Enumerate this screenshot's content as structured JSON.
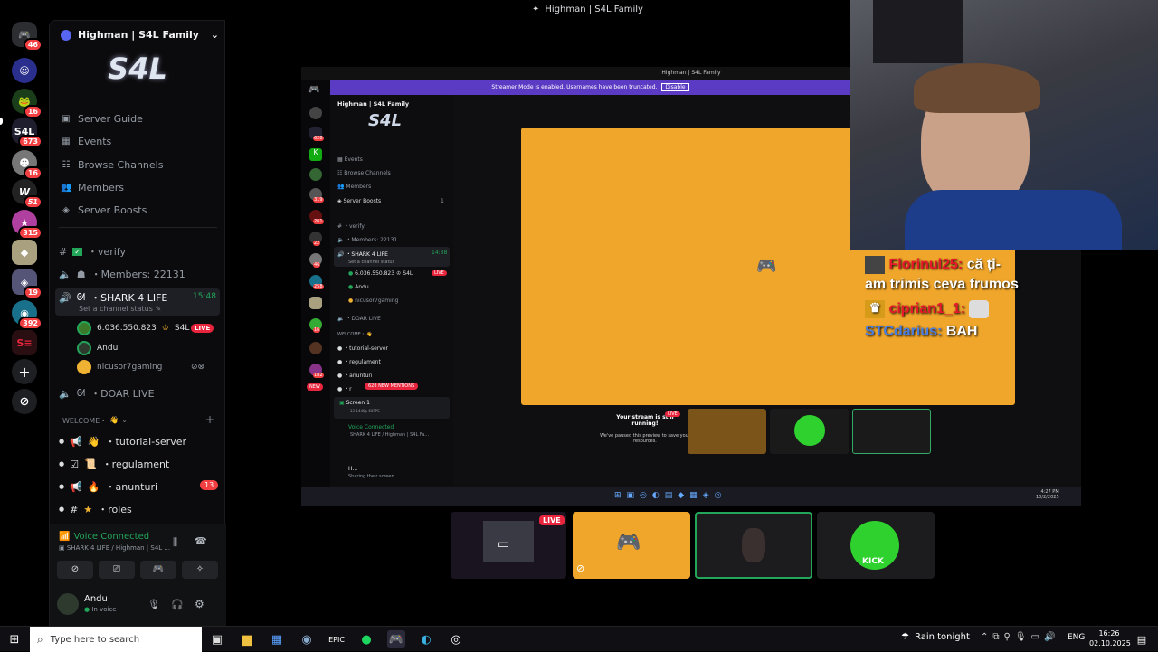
{
  "window_title": "Highman | S4L Family",
  "rail": {
    "badges": [
      "46",
      "16",
      "673",
      "16",
      "51",
      "315",
      "19",
      "392"
    ]
  },
  "server": {
    "name": "Highman | S4L Family",
    "menu": [
      {
        "icon": "guide-icon",
        "label": "Server Guide"
      },
      {
        "icon": "events-icon",
        "label": "Events"
      },
      {
        "icon": "browse-icon",
        "label": "Browse Channels"
      },
      {
        "icon": "members-icon",
        "label": "Members"
      },
      {
        "icon": "boost-icon",
        "label": "Server Boosts"
      }
    ],
    "channels": {
      "verify": "・verify",
      "members": "・Members: 22131",
      "voice": "・SHARK 4 LIFE",
      "voice_time": "15:48",
      "voice_status": "Set a channel status",
      "users": [
        {
          "name": "6.036.550.823",
          "tag": "S4L",
          "live": "LIVE"
        },
        {
          "name": "Andu"
        },
        {
          "name": "nicusor7gaming"
        }
      ],
      "doar_live": "・DOAR LIVE",
      "category": "WELCOME・",
      "text_channels": [
        {
          "label": "・tutorial-server"
        },
        {
          "label": "・regulament"
        },
        {
          "label": "・anunturi",
          "badge": "13"
        },
        {
          "label": "・roles"
        }
      ]
    },
    "voice_connected": {
      "title": "Voice Connected",
      "subtitle": "SHARK 4 LIFE / Highman | S4L ..."
    },
    "user": {
      "name": "Andu",
      "status": "In voice"
    }
  },
  "nested": {
    "title": "Highman | S4L Family",
    "banner": "Streamer Mode is enabled. Usernames have been truncated.",
    "banner_btn": "Disable",
    "server_name": "Highman | S4L Family",
    "menu": [
      "Events",
      "Browse Channels",
      "Members",
      "Server Boosts"
    ],
    "boost_count": "1",
    "verify": "・verify",
    "members": "・Members: 22131",
    "voice": "・SHARK 4 LIFE",
    "voice_time": "14:38",
    "voice_status": "Set a channel status",
    "users": [
      "6.036.550.823",
      "Andu",
      "nicusor7gaming"
    ],
    "user_tag": "S4L",
    "live": "LIVE",
    "doar_live": "・DOAR LIVE",
    "category": "WELCOME・",
    "text_channels": [
      "・tutorial-server",
      "・regulament",
      "・anunturi",
      "・r"
    ],
    "mentions": "628 NEW MENTIONS",
    "new": "NEW",
    "screen_title": "Screen 1",
    "screen_sub": "13 1440p 60FPS",
    "vc_title": "Voice Connected",
    "vc_sub": "SHARK 4 LIFE / Highman | S4L Fa...",
    "me_name": "H...",
    "me_status": "Sharing their screen",
    "stream_msg": "Your stream is still running!",
    "stream_sub": "We've paused this preview to save your resources.",
    "stream_live": "LIVE",
    "rail_badges": [
      "628",
      "319",
      "1",
      "261",
      "22",
      "46",
      "258",
      "16",
      "182"
    ],
    "clock_time": "4:27 PM",
    "clock_date": "10/2/2025"
  },
  "stream": {
    "live": "LIVE"
  },
  "kick_label": "KICK",
  "chat": [
    {
      "name": "Florinul25:",
      "color": "#e8182b",
      "text": "că ți-am trimis ceva frumos"
    },
    {
      "name": "ciprian1_1:",
      "color": "#e8182b",
      "text": ""
    },
    {
      "name": "STCdarius:",
      "color": "#4a7ee0",
      "text": "BAH"
    }
  ],
  "taskbar": {
    "search_placeholder": "Type here to search",
    "weather": "Rain tonight",
    "lang": "ENG",
    "time": "16:26",
    "date": "02.10.2025"
  },
  "colors": {
    "discord_orange": "#f0a62b",
    "accent": "#5865f2",
    "live": "#e8253c",
    "green": "#23a55a"
  }
}
